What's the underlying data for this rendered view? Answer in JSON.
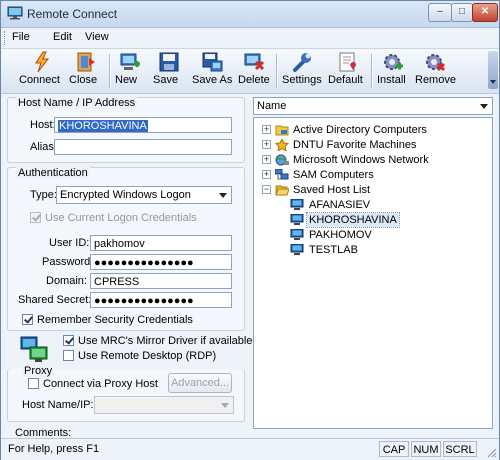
{
  "window": {
    "title": "Remote Connect",
    "buttons": {
      "minimize": "–",
      "maximize": "□",
      "close": "✕"
    }
  },
  "menu": {
    "file": "File",
    "edit": "Edit",
    "view": "View"
  },
  "toolbar": {
    "connect": "Connect",
    "close": "Close",
    "new": "New",
    "save": "Save",
    "save_as": "Save As",
    "delete": "Delete",
    "settings": "Settings",
    "default": "Default",
    "install": "Install",
    "remove": "Remove"
  },
  "host": {
    "group_title": "Host Name / IP Address",
    "host_label": "Host:",
    "host_value": "KHOROSHAVINA",
    "alias_label": "Alias:",
    "alias_value": ""
  },
  "auth": {
    "group_title": "Authentication",
    "type_label": "Type:",
    "type_value": "Encrypted Windows Logon",
    "use_current_label": "Use Current Logon Credentials",
    "use_current_checked": true,
    "user_id_label": "User ID:",
    "user_id_value": "pakhomov",
    "password_label": "Password:",
    "password_value": "●●●●●●●●●●●●●●●",
    "domain_label": "Domain:",
    "domain_value": "CPRESS",
    "secret_label": "Shared Secret:",
    "secret_value": "●●●●●●●●●●●●●●●",
    "remember_label": "Remember Security Credentials",
    "remember_checked": true
  },
  "display": {
    "mirror_label": "Use MRC's Mirror Driver if available",
    "mirror_checked": true,
    "rdp_label": "Use Remote Desktop (RDP)",
    "rdp_checked": false
  },
  "proxy": {
    "group_title": "Proxy",
    "via_label": "Connect via Proxy Host",
    "via_checked": false,
    "advanced_label": "Advanced...",
    "host_label": "Host Name/IP:",
    "host_value": ""
  },
  "comments_label": "Comments:",
  "tree": {
    "header": "Name",
    "nodes": [
      {
        "label": "Active Directory Computers",
        "expander": "+"
      },
      {
        "label": "DNTU Favorite Machines",
        "expander": "+"
      },
      {
        "label": "Microsoft Windows Network",
        "expander": "+"
      },
      {
        "label": "SAM Computers",
        "expander": "+"
      },
      {
        "label": "Saved Host List",
        "expander": "−"
      }
    ],
    "children": [
      "AFANASIEV",
      "KHOROSHAVINA",
      "PAKHOMOV",
      "TESTLAB"
    ],
    "selected_child": "KHOROSHAVINA"
  },
  "status": {
    "text": "For Help, press F1",
    "cap": "CAP",
    "num": "NUM",
    "scrl": "SCRL"
  },
  "colors": {
    "accent": "#3169c6",
    "window_bg": "#eef3fa"
  }
}
